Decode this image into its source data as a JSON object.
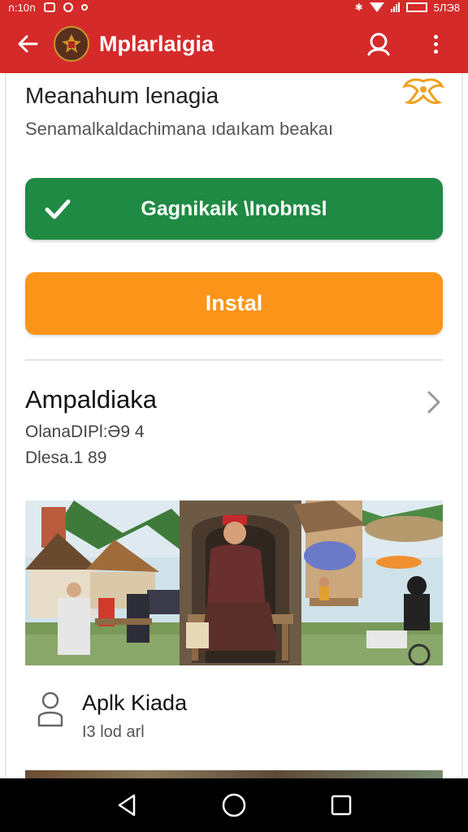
{
  "status_bar": {
    "left_text": "ก:10ก",
    "right_text": "5ЛЭ8"
  },
  "app_bar": {
    "title": "Mplarlaigia"
  },
  "header": {
    "heading": "Meanahum lenagia",
    "subheading": "Senamalkaldachimana ıdaıkam beakaı"
  },
  "buttons": {
    "primary_label": "Gagnikaik \\Inobmsl",
    "install_label": "Instal"
  },
  "section": {
    "title": "Ampaldiaka",
    "meta1": "OlanaDIPl:Ə9 4",
    "meta2": "Dlesa.1 89"
  },
  "list_item": {
    "title": "Aplk Kiada",
    "subtitle": "I3 lod arl"
  },
  "colors": {
    "app_bar": "#d52a2a",
    "primary": "#1f8a43",
    "install": "#fb9418"
  },
  "icons": {
    "back": "arrow-left-icon",
    "profile": "account-icon",
    "menu": "more-vertical-icon",
    "check": "check-icon",
    "chevron": "chevron-right-icon",
    "person": "person-icon"
  }
}
